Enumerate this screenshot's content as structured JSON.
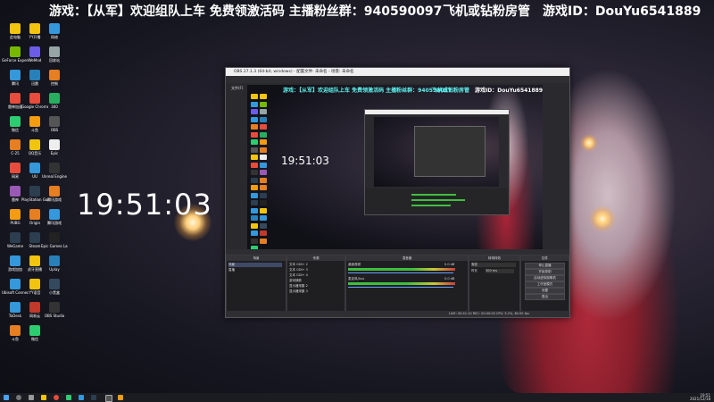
{
  "stream_overlay": {
    "part1": "游戏：【从军】欢迎组队上车  免费领激活码  主播粉丝群：940590097",
    "part2": "飞机或钻粉房管",
    "part3": "游戏ID：DouYu6541889"
  },
  "desktop": {
    "clock": "19:51:03",
    "icons": [
      {
        "label": "此电脑",
        "color": "#f1c40f"
      },
      {
        "label": "YY开播",
        "color": "#f1c40f"
      },
      {
        "label": "网络",
        "color": "#3498db"
      },
      {
        "label": "GeForce Experience",
        "color": "#76b900"
      },
      {
        "label": "WeMod",
        "color": "#6c5ce7"
      },
      {
        "label": "回收站",
        "color": "#95a5a6"
      },
      {
        "label": "腾讯",
        "color": "#3498db"
      },
      {
        "label": "迅雷",
        "color": "#2980b9"
      },
      {
        "label": "控制",
        "color": "#e67e22"
      },
      {
        "label": "雷神加速",
        "color": "#e74c3c"
      },
      {
        "label": "Google Chrome",
        "color": "#e74c3c"
      },
      {
        "label": "360",
        "color": "#27ae60"
      },
      {
        "label": "微信",
        "color": "#2ecc71"
      },
      {
        "label": "斗鱼",
        "color": "#f39c12"
      },
      {
        "label": "OBS",
        "color": "#555"
      },
      {
        "label": "C-25",
        "color": "#e67e22"
      },
      {
        "label": "QQ音乐",
        "color": "#f1c40f"
      },
      {
        "label": "Epic",
        "color": "#eee"
      },
      {
        "label": "网易",
        "color": "#e74c3c"
      },
      {
        "label": "UU",
        "color": "#3498db"
      },
      {
        "label": "Unreal Engine",
        "color": "#333"
      },
      {
        "label": "雷神",
        "color": "#9b59b6"
      },
      {
        "label": "PlayStation Games",
        "color": "#2c3e50"
      },
      {
        "label": "腾讯游戏",
        "color": "#e67e22"
      },
      {
        "label": "PUBG",
        "color": "#f39c12"
      },
      {
        "label": "Origin",
        "color": "#e67e22"
      },
      {
        "label": "腾讯游戏",
        "color": "#3498db"
      },
      {
        "label": "WeGame",
        "color": "#2c3e50"
      },
      {
        "label": "Steam",
        "color": "#2c3e50"
      },
      {
        "label": "Epic Games Launcher",
        "color": "#222"
      },
      {
        "label": "游戏加加",
        "color": "#3498db"
      },
      {
        "label": "虎牙直播",
        "color": "#f1c40f"
      },
      {
        "label": "Uplay",
        "color": "#2980b9"
      },
      {
        "label": "Ubisoft Connect",
        "color": "#3498db"
      },
      {
        "label": "YY语音",
        "color": "#f1c40f"
      },
      {
        "label": "小黑盒",
        "color": "#34495e"
      },
      {
        "label": "ToDesk",
        "color": "#3498db"
      },
      {
        "label": "网易云",
        "color": "#c0392b"
      },
      {
        "label": "OBS Studio",
        "color": "#333"
      },
      {
        "label": "斗鱼",
        "color": "#e67e22"
      },
      {
        "label": "微信",
        "color": "#2ecc71"
      }
    ]
  },
  "obs": {
    "title": "OBS 27.1.3 (64-bit, windows) - 配置文件: 未命名 - 场景: 未命名",
    "window_buttons": {
      "minimize": "─",
      "maximize": "☐",
      "close": "✕"
    },
    "menu": [
      "文件(F)",
      "编辑(E)",
      "视图(V)",
      "停靠部件(D)",
      "配置文件(P)",
      "场景集合(S)",
      "工具(T)",
      "帮助(H)"
    ],
    "preview_clock": "19:51:03",
    "scene_tabs": [
      "来源错误",
      "混音",
      "滤镜"
    ],
    "docks": {
      "scenes": {
        "title": "场景",
        "items": [
          "场景",
          "直播"
        ]
      },
      "sources": {
        "title": "来源",
        "items": [
          "文本 GDI+ 2",
          "文本 GDI+ 3",
          "文本 GDI+ 4",
          "游戏捕获",
          "显示器采集 2",
          "显示器采集 3"
        ]
      },
      "mixer": {
        "title": "混音器",
        "channels": [
          {
            "name": "桌面音频",
            "db": "0.0 dB"
          },
          {
            "name": "麦克风/Aux",
            "db": "0.0 dB"
          }
        ]
      },
      "transitions": {
        "title": "转场特效",
        "type": "渐变",
        "duration_label": "时长",
        "duration": "300 ms"
      },
      "controls": {
        "title": "控件",
        "buttons": [
          "停止直播",
          "开始录制",
          "启动虚拟摄像机",
          "工作室模式",
          "设置",
          "退出"
        ]
      }
    },
    "status": "LIVE: 00:41:10   REC: 00:00:00   CPU: 5.2%, 60.00 fps"
  },
  "taskbar": {
    "time": "19:51",
    "date": "2021/12/18"
  }
}
